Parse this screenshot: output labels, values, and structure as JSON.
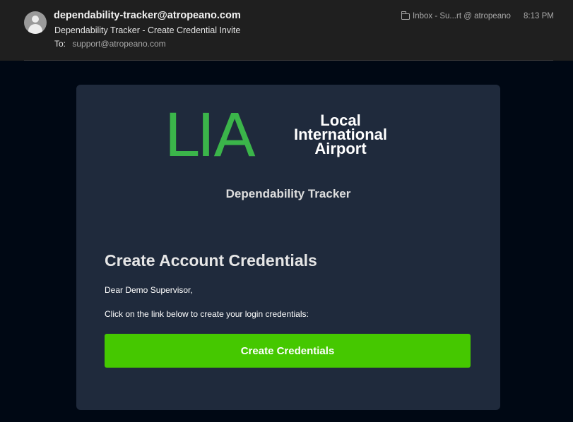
{
  "email": {
    "sender": "dependability-tracker@atropeano.com",
    "subject": "Dependability Tracker - Create Credential Invite",
    "to_label": "To:",
    "to_value": "support@atropeano.com",
    "mailbox": "Inbox - Su...rt @ atropeano",
    "time": "8:13 PM",
    "icons": [
      "avatar-icon",
      "folder-icon"
    ]
  },
  "body": {
    "logo_mark": "LIA",
    "logo_text": [
      "Local",
      "International",
      "Airport"
    ],
    "app_name": "Dependability Tracker",
    "title": "Create Account Credentials",
    "greeting": "Dear Demo Supervisor,",
    "instructions": "Click on the link below to create your login credentials:",
    "button_label": "Create Credentials"
  },
  "colors": {
    "page_background": "#000814",
    "header_background": "#1f1f1f",
    "card_background": "#1f2a3c",
    "logo_green": "#3bb54a",
    "button_green": "#45c800"
  }
}
